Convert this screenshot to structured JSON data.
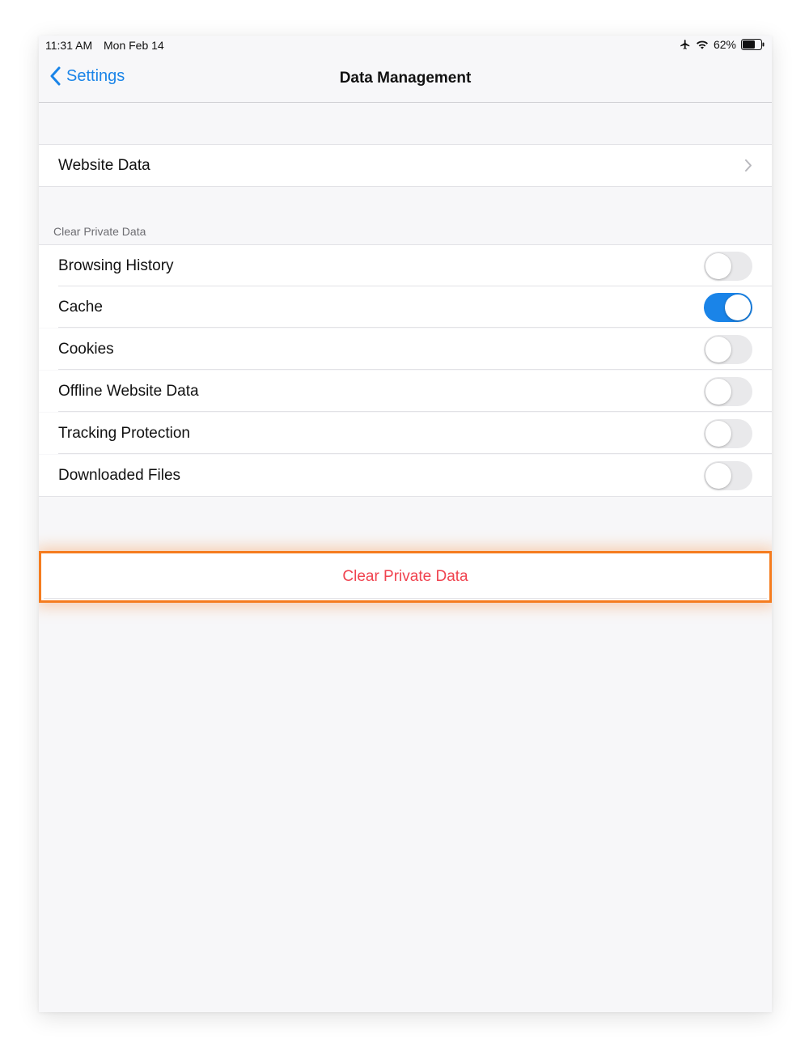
{
  "status": {
    "time": "11:31 AM",
    "date": "Mon Feb 14",
    "battery": "62%"
  },
  "nav": {
    "back_label": "Settings",
    "title": "Data Management"
  },
  "website_data": {
    "label": "Website Data"
  },
  "section": {
    "header": "Clear Private Data"
  },
  "toggles": [
    {
      "label": "Browsing History",
      "on": false
    },
    {
      "label": "Cache",
      "on": true
    },
    {
      "label": "Cookies",
      "on": false
    },
    {
      "label": "Offline Website Data",
      "on": false
    },
    {
      "label": "Tracking Protection",
      "on": false
    },
    {
      "label": "Downloaded Files",
      "on": false
    }
  ],
  "clear_button": {
    "label": "Clear Private Data"
  },
  "colors": {
    "accent": "#1a84e8",
    "destructive": "#f0434f",
    "highlight": "#f57c1f"
  }
}
